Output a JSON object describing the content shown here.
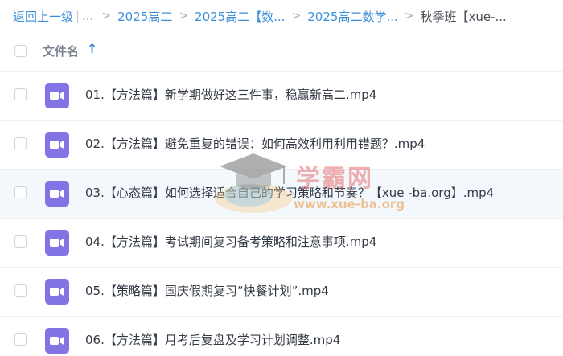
{
  "breadcrumb": {
    "back": "返回上一级",
    "separator": "|",
    "ellipsis": "...",
    "items": [
      "2025高二",
      "2025高二【数...",
      "2025高二数学..."
    ],
    "current": "秋季班【xue-..."
  },
  "header": {
    "column_name": "文件名",
    "sort_glyph": "↑"
  },
  "files": [
    {
      "name": "01.【方法篇】新学期做好这三件事，稳赢新高二.mp4"
    },
    {
      "name": "02.【方法篇】避免重复的错误：如何高效利用利用错题？.mp4"
    },
    {
      "name": "03.【心态篇】如何选择适合自己的学习策略和节奏？【xue -ba.org】.mp4"
    },
    {
      "name": "04.【方法篇】考试期间复习备考策略和注意事项.mp4"
    },
    {
      "name": "05.【策略篇】国庆假期复习“快餐计划”.mp4"
    },
    {
      "name": "06.【方法篇】月考后复盘及学习计划调整.mp4"
    }
  ],
  "watermark": {
    "brand": "学霸网",
    "url": "www.xue-ba.org"
  },
  "colors": {
    "link": "#3b8ed8",
    "video_icon": "#8374e6",
    "row_highlight": "#f3f8fd"
  }
}
